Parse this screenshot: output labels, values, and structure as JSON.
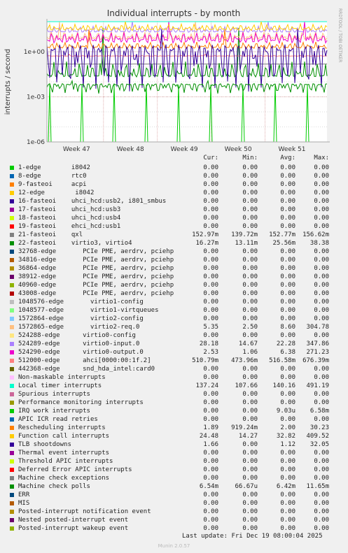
{
  "chart_data": {
    "type": "line",
    "title": "Individual interrupts - by month",
    "ylabel": "interrupts / second",
    "yscale": "log",
    "ylim": [
      1e-06,
      100
    ],
    "yticks": [
      {
        "value": 1,
        "label": "1e+00"
      },
      {
        "value": 0.001,
        "label": "1e-03"
      },
      {
        "value": 1e-06,
        "label": "1e-06"
      }
    ],
    "x_ticks": [
      "Week 47",
      "Week 48",
      "Week 49",
      "Week 50",
      "Week 51"
    ],
    "grid": true,
    "watermark": "RRDTOOL / TOBI OETIKER",
    "columns": [
      "Cur:",
      "Min:",
      "Avg:",
      "Max:"
    ],
    "series": [
      {
        "name": "1-edge        i8042",
        "color": "#00cc00",
        "cur": "0.00",
        "min": "0.00",
        "avg": "0.00",
        "max": "0.00"
      },
      {
        "name": "8-edge        rtc0",
        "color": "#0066b3",
        "cur": "0.00",
        "min": "0.00",
        "avg": "0.00",
        "max": "0.00"
      },
      {
        "name": "9-fasteoi     acpi",
        "color": "#ff8000",
        "cur": "0.00",
        "min": "0.00",
        "avg": "0.00",
        "max": "0.00"
      },
      {
        "name": "12-edge        i8042",
        "color": "#ffcc00",
        "cur": "0.00",
        "min": "0.00",
        "avg": "0.00",
        "max": "0.00"
      },
      {
        "name": "16-fasteoi    uhci_hcd:usb2, i801_smbus",
        "color": "#330099",
        "cur": "0.00",
        "min": "0.00",
        "avg": "0.00",
        "max": "0.00"
      },
      {
        "name": "17-fasteoi    uhci_hcd:usb3",
        "color": "#990099",
        "cur": "0.00",
        "min": "0.00",
        "avg": "0.00",
        "max": "0.00"
      },
      {
        "name": "18-fasteoi    uhci_hcd:usb4",
        "color": "#ccff00",
        "cur": "0.00",
        "min": "0.00",
        "avg": "0.00",
        "max": "0.00"
      },
      {
        "name": "19-fasteoi    ehci_hcd:usb1",
        "color": "#ff0000",
        "cur": "0.00",
        "min": "0.00",
        "avg": "0.00",
        "max": "0.00"
      },
      {
        "name": "21-fasteoi    qxl",
        "color": "#808080",
        "cur": "152.97m",
        "min": "139.72m",
        "avg": "152.77m",
        "max": "156.62m"
      },
      {
        "name": "22-fasteoi    virtio3, virtio4",
        "color": "#008f00",
        "cur": "16.27m",
        "min": "13.11m",
        "avg": "25.56m",
        "max": "38.38"
      },
      {
        "name": "32768-edge       PCIe PME, aerdrv, pciehp",
        "color": "#00487d",
        "cur": "0.00",
        "min": "0.00",
        "avg": "0.00",
        "max": "0.00"
      },
      {
        "name": "34816-edge       PCIe PME, aerdrv, pciehp",
        "color": "#b35a00",
        "cur": "0.00",
        "min": "0.00",
        "avg": "0.00",
        "max": "0.00"
      },
      {
        "name": "36864-edge       PCIe PME, aerdrv, pciehp",
        "color": "#b38f00",
        "cur": "0.00",
        "min": "0.00",
        "avg": "0.00",
        "max": "0.00"
      },
      {
        "name": "38912-edge       PCIe PME, aerdrv, pciehp",
        "color": "#6b006b",
        "cur": "0.00",
        "min": "0.00",
        "avg": "0.00",
        "max": "0.00"
      },
      {
        "name": "40960-edge       PCIe PME, aerdrv, pciehp",
        "color": "#8fb300",
        "cur": "0.00",
        "min": "0.00",
        "avg": "0.00",
        "max": "0.00"
      },
      {
        "name": "43008-edge       PCIe PME, aerdrv, pciehp",
        "color": "#b30000",
        "cur": "0.00",
        "min": "0.00",
        "avg": "0.00",
        "max": "0.00"
      },
      {
        "name": "1048576-edge       virtio1-config",
        "color": "#bebebe",
        "cur": "0.00",
        "min": "0.00",
        "avg": "0.00",
        "max": "0.00"
      },
      {
        "name": "1048577-edge       virtio1-virtqueues",
        "color": "#80ff80",
        "cur": "0.00",
        "min": "0.00",
        "avg": "0.00",
        "max": "0.00"
      },
      {
        "name": "1572864-edge       virtio2-config",
        "color": "#80c9ff",
        "cur": "0.00",
        "min": "0.00",
        "avg": "0.00",
        "max": "0.00"
      },
      {
        "name": "1572865-edge       virtio2-req.0",
        "color": "#ffc080",
        "cur": "5.35",
        "min": "2.50",
        "avg": "8.60",
        "max": "304.78"
      },
      {
        "name": "524288-edge      virtio0-config",
        "color": "#ffe680",
        "cur": "0.00",
        "min": "0.00",
        "avg": "0.00",
        "max": "0.00"
      },
      {
        "name": "524289-edge      virtio0-input.0",
        "color": "#aa80ff",
        "cur": "28.18",
        "min": "14.67",
        "avg": "22.28",
        "max": "347.86"
      },
      {
        "name": "524290-edge      virtio0-output.0",
        "color": "#ee00cc",
        "cur": "2.53",
        "min": "1.06",
        "avg": "6.38",
        "max": "271.23"
      },
      {
        "name": "512000-edge      ahci[0000:00:1f.2]",
        "color": "#ff8080",
        "cur": "510.79m",
        "min": "473.96m",
        "avg": "516.58m",
        "max": "676.39m"
      },
      {
        "name": "442368-edge      snd_hda_intel:card0",
        "color": "#666600",
        "cur": "0.00",
        "min": "0.00",
        "avg": "0.00",
        "max": "0.00"
      },
      {
        "name": "Non-maskable interrupts",
        "color": "#ffbfff",
        "cur": "0.00",
        "min": "0.00",
        "avg": "0.00",
        "max": "0.00"
      },
      {
        "name": "Local timer interrupts",
        "color": "#00ffcc",
        "cur": "137.24",
        "min": "107.66",
        "avg": "140.16",
        "max": "491.19"
      },
      {
        "name": "Spurious interrupts",
        "color": "#cc6699",
        "cur": "0.00",
        "min": "0.00",
        "avg": "0.00",
        "max": "0.00"
      },
      {
        "name": "Performance monitoring interrupts",
        "color": "#999900",
        "cur": "0.00",
        "min": "0.00",
        "avg": "0.00",
        "max": "0.00"
      },
      {
        "name": "IRQ work interrupts",
        "color": "#00cc00",
        "cur": "0.00",
        "min": "0.00",
        "avg": "9.03u",
        "max": "6.58m"
      },
      {
        "name": "APIC ICR read retries",
        "color": "#0066b3",
        "cur": "0.00",
        "min": "0.00",
        "avg": "0.00",
        "max": "0.00"
      },
      {
        "name": "Rescheduling interrupts",
        "color": "#ff8000",
        "cur": "1.89",
        "min": "919.24m",
        "avg": "2.00",
        "max": "30.23"
      },
      {
        "name": "Function call interrupts",
        "color": "#ffcc00",
        "cur": "24.48",
        "min": "14.27",
        "avg": "32.82",
        "max": "409.52"
      },
      {
        "name": "TLB shootdowns",
        "color": "#330099",
        "cur": "1.66",
        "min": "0.00",
        "avg": "1.12",
        "max": "32.05"
      },
      {
        "name": "Thermal event interrupts",
        "color": "#990099",
        "cur": "0.00",
        "min": "0.00",
        "avg": "0.00",
        "max": "0.00"
      },
      {
        "name": "Threshold APIC interrupts",
        "color": "#ccff00",
        "cur": "0.00",
        "min": "0.00",
        "avg": "0.00",
        "max": "0.00"
      },
      {
        "name": "Deferred Error APIC interrupts",
        "color": "#ff0000",
        "cur": "0.00",
        "min": "0.00",
        "avg": "0.00",
        "max": "0.00"
      },
      {
        "name": "Machine check exceptions",
        "color": "#808080",
        "cur": "0.00",
        "min": "0.00",
        "avg": "0.00",
        "max": "0.00"
      },
      {
        "name": "Machine check polls",
        "color": "#008f00",
        "cur": "6.54m",
        "min": "66.67u",
        "avg": "6.42m",
        "max": "11.65m"
      },
      {
        "name": "ERR",
        "color": "#00487d",
        "cur": "0.00",
        "min": "0.00",
        "avg": "0.00",
        "max": "0.00"
      },
      {
        "name": "MIS",
        "color": "#b35a00",
        "cur": "0.00",
        "min": "0.00",
        "avg": "0.00",
        "max": "0.00"
      },
      {
        "name": "Posted-interrupt notification event",
        "color": "#b38f00",
        "cur": "0.00",
        "min": "0.00",
        "avg": "0.00",
        "max": "0.00"
      },
      {
        "name": "Nested posted-interrupt event",
        "color": "#6b006b",
        "cur": "0.00",
        "min": "0.00",
        "avg": "0.00",
        "max": "0.00"
      },
      {
        "name": "Posted-interrupt wakeup event",
        "color": "#8fb300",
        "cur": "0.00",
        "min": "0.00",
        "avg": "0.00",
        "max": "0.00"
      }
    ]
  },
  "footer": {
    "last_update": "Last update: Fri Dec 19 08:00:04 2025",
    "version": "Munin 2.0.57"
  }
}
